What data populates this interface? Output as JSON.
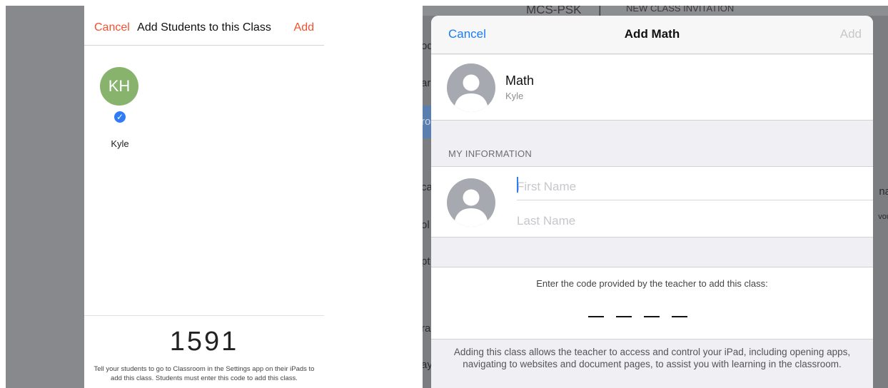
{
  "left_panel": {
    "nav": {
      "cancel_label": "Cancel",
      "title": "Add Students to this Class",
      "add_label": "Add"
    },
    "student": {
      "initials": "KH",
      "name": "Kyle",
      "check_glyph": "✓",
      "avatar_color": "#87b36c",
      "selected": true
    },
    "class_code": "1591",
    "help_text": "Tell your students to go to Classroom in the Settings app on their iPads to add this class. Students must enter this code to add this class.",
    "accent_color": "#f2512e"
  },
  "right_panel": {
    "background_fragments": {
      "top_left": "MCS-PSK",
      "top_sep": "|",
      "top_right": "NEW CLASS INVITATION",
      "left_edge": [
        "od",
        "ar",
        "ro",
        "ca",
        "ol",
        "pt",
        "ra",
        "ay"
      ],
      "right_edge": [
        "na",
        "vou"
      ]
    },
    "nav": {
      "cancel_label": "Cancel",
      "title": "Add Math",
      "add_label": "Add"
    },
    "class_info": {
      "name": "Math",
      "teacher": "Kyle",
      "avatar_icon": "person-silhouette-icon"
    },
    "my_information": {
      "header": "MY INFORMATION",
      "first_name": {
        "value": "",
        "placeholder": "First Name"
      },
      "last_name": {
        "value": "",
        "placeholder": "Last Name"
      },
      "avatar_icon": "person-silhouette-icon"
    },
    "code_entry": {
      "instruction": "Enter the code provided by the teacher to add this class:",
      "slots": 4
    },
    "disclaimer": "Adding this class allows the teacher to access and control your iPad, including opening apps, navigating to websites and document pages, to assist you with learning in the classroom.",
    "accent_color": "#1a7cf6"
  }
}
